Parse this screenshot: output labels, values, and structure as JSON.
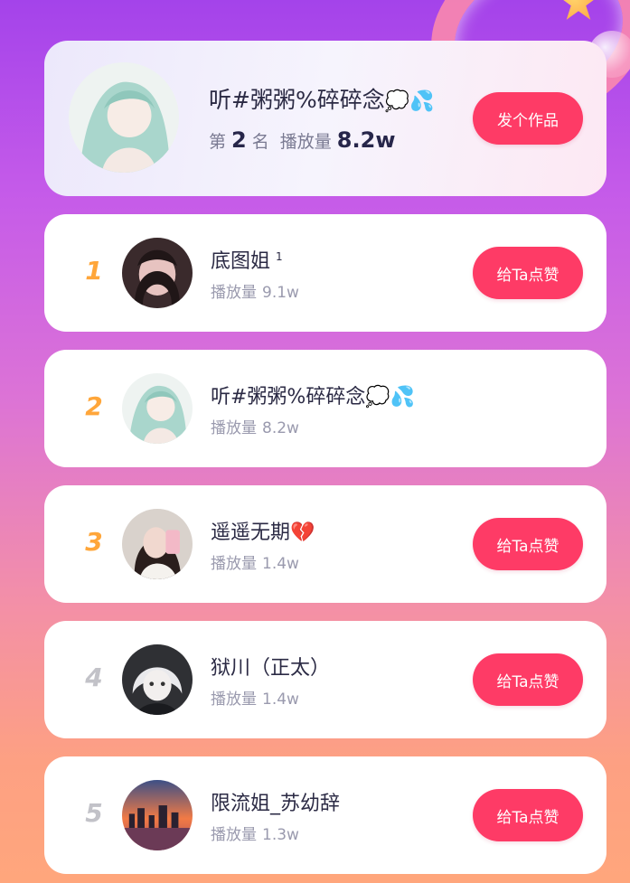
{
  "colors": {
    "accent": "#fe3b66",
    "rank_top": "#ffa63a",
    "rank_other": "#c2c2c8"
  },
  "current_user": {
    "name": "听#粥粥%碎碎念",
    "emojis": "💭💦",
    "rank_prefix": "第",
    "rank": "2",
    "rank_suffix": "名",
    "plays_label": "播放量",
    "plays": "8.2w",
    "button": "发个作品",
    "avatar_icon": "anime-avatar-icon"
  },
  "ranking": [
    {
      "rank": "1",
      "name": "底图姐",
      "badge": "1",
      "emojis": "",
      "plays_label": "播放量",
      "plays": "9.1w",
      "button": "给Ta点赞"
    },
    {
      "rank": "2",
      "name": "听#粥粥%碎碎念",
      "badge": "",
      "emojis": "💭💦",
      "plays_label": "播放量",
      "plays": "8.2w",
      "button": ""
    },
    {
      "rank": "3",
      "name": "遥遥无期",
      "badge": "",
      "emojis": "💔",
      "plays_label": "播放量",
      "plays": "1.4w",
      "button": "给Ta点赞"
    },
    {
      "rank": "4",
      "name": "狱川（正太）",
      "badge": "",
      "emojis": "",
      "plays_label": "播放量",
      "plays": "1.4w",
      "button": "给Ta点赞"
    },
    {
      "rank": "5",
      "name": "限流姐_苏幼辞",
      "badge": "",
      "emojis": "",
      "plays_label": "播放量",
      "plays": "1.3w",
      "button": "给Ta点赞"
    }
  ]
}
